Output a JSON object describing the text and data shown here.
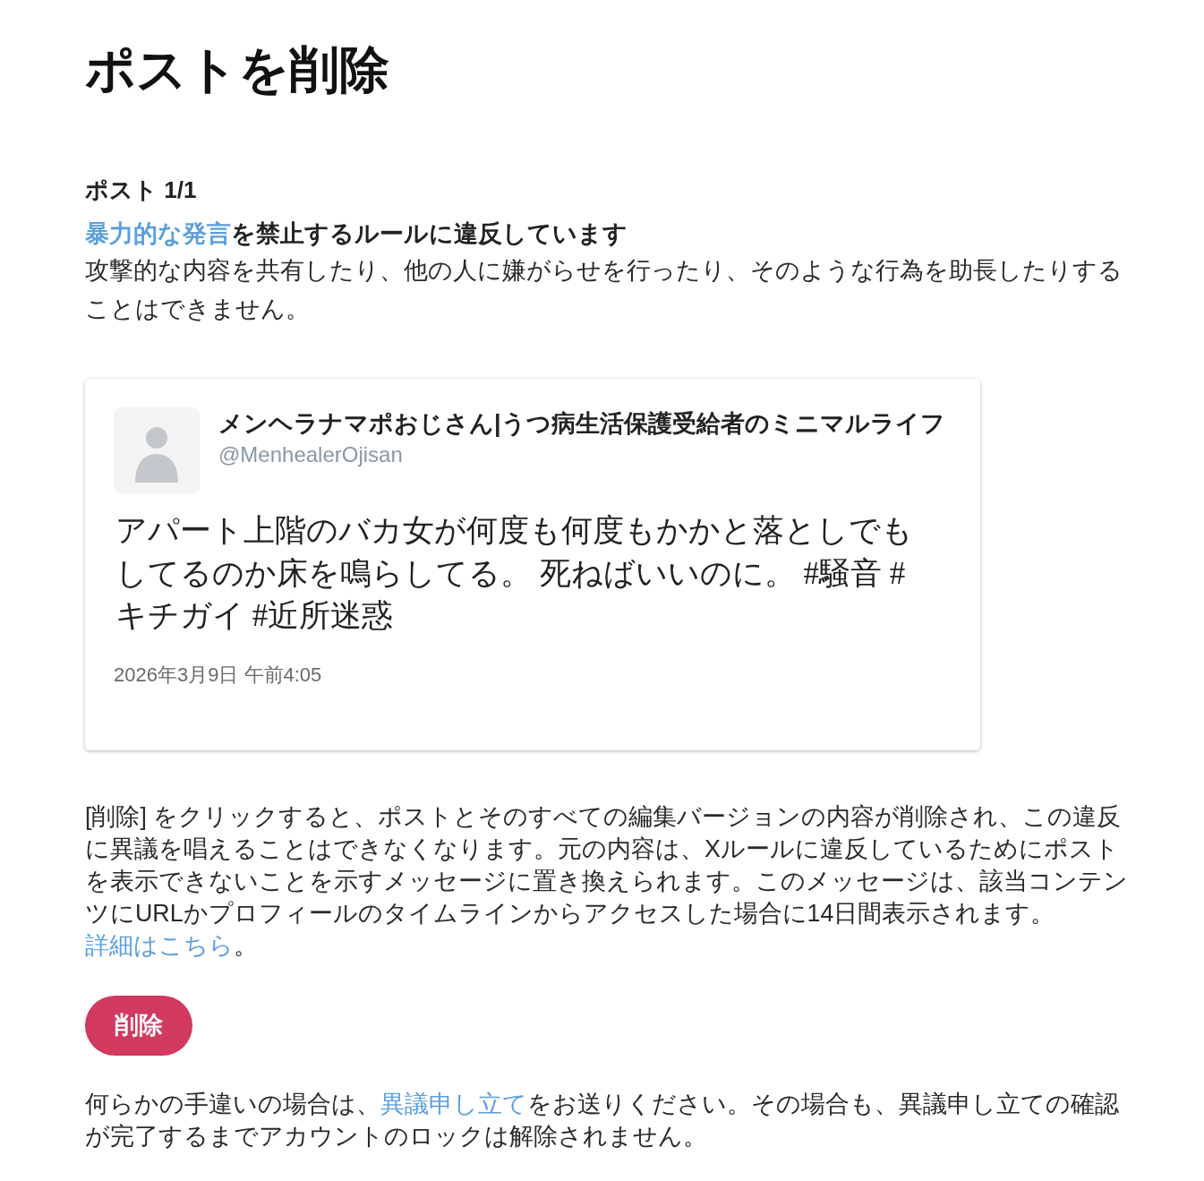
{
  "page_title": "ポストを削除",
  "post_counter": "ポスト 1/1",
  "violation": {
    "rule_link": "暴力的な発言",
    "statement": "を禁止するルールに違反しています",
    "description": "攻撃的な内容を共有したり、他の人に嫌がらせを行ったり、そのような行為を助長したりすることはできません。"
  },
  "post": {
    "author_name": "メンヘラナマポおじさん|うつ病生活保護受給者のミニマルライフ",
    "handle": "@MenhealerOjisan",
    "text": "アパート上階のバカ女が何度も何度もかかと落としでもしてるのか床を鳴らしてる。 死ねばいいのに。 #騒音 #キチガイ #近所迷惑",
    "timestamp": "2026年3月9日 午前4:05"
  },
  "deletion_notice": {
    "text": "[削除] をクリックすると、ポストとそのすべての編集バージョンの内容が削除され、この違反に異議を唱えることはできなくなります。元の内容は、Xルールに違反しているためにポストを表示できないことを示すメッセージに置き換えられます。このメッセージは、該当コンテンツにURLかプロフィールのタイムラインからアクセスした場合に14日間表示されます。",
    "link": "詳細はこちら",
    "text_after": "。"
  },
  "delete_button": "削除",
  "appeal_notice": {
    "text_before": "何らかの手違いの場合は、",
    "link": "異議申し立て",
    "text_after": "をお送りください。その場合も、異議申し立ての確認が完了するまでアカウントのロックは解除されません。"
  }
}
